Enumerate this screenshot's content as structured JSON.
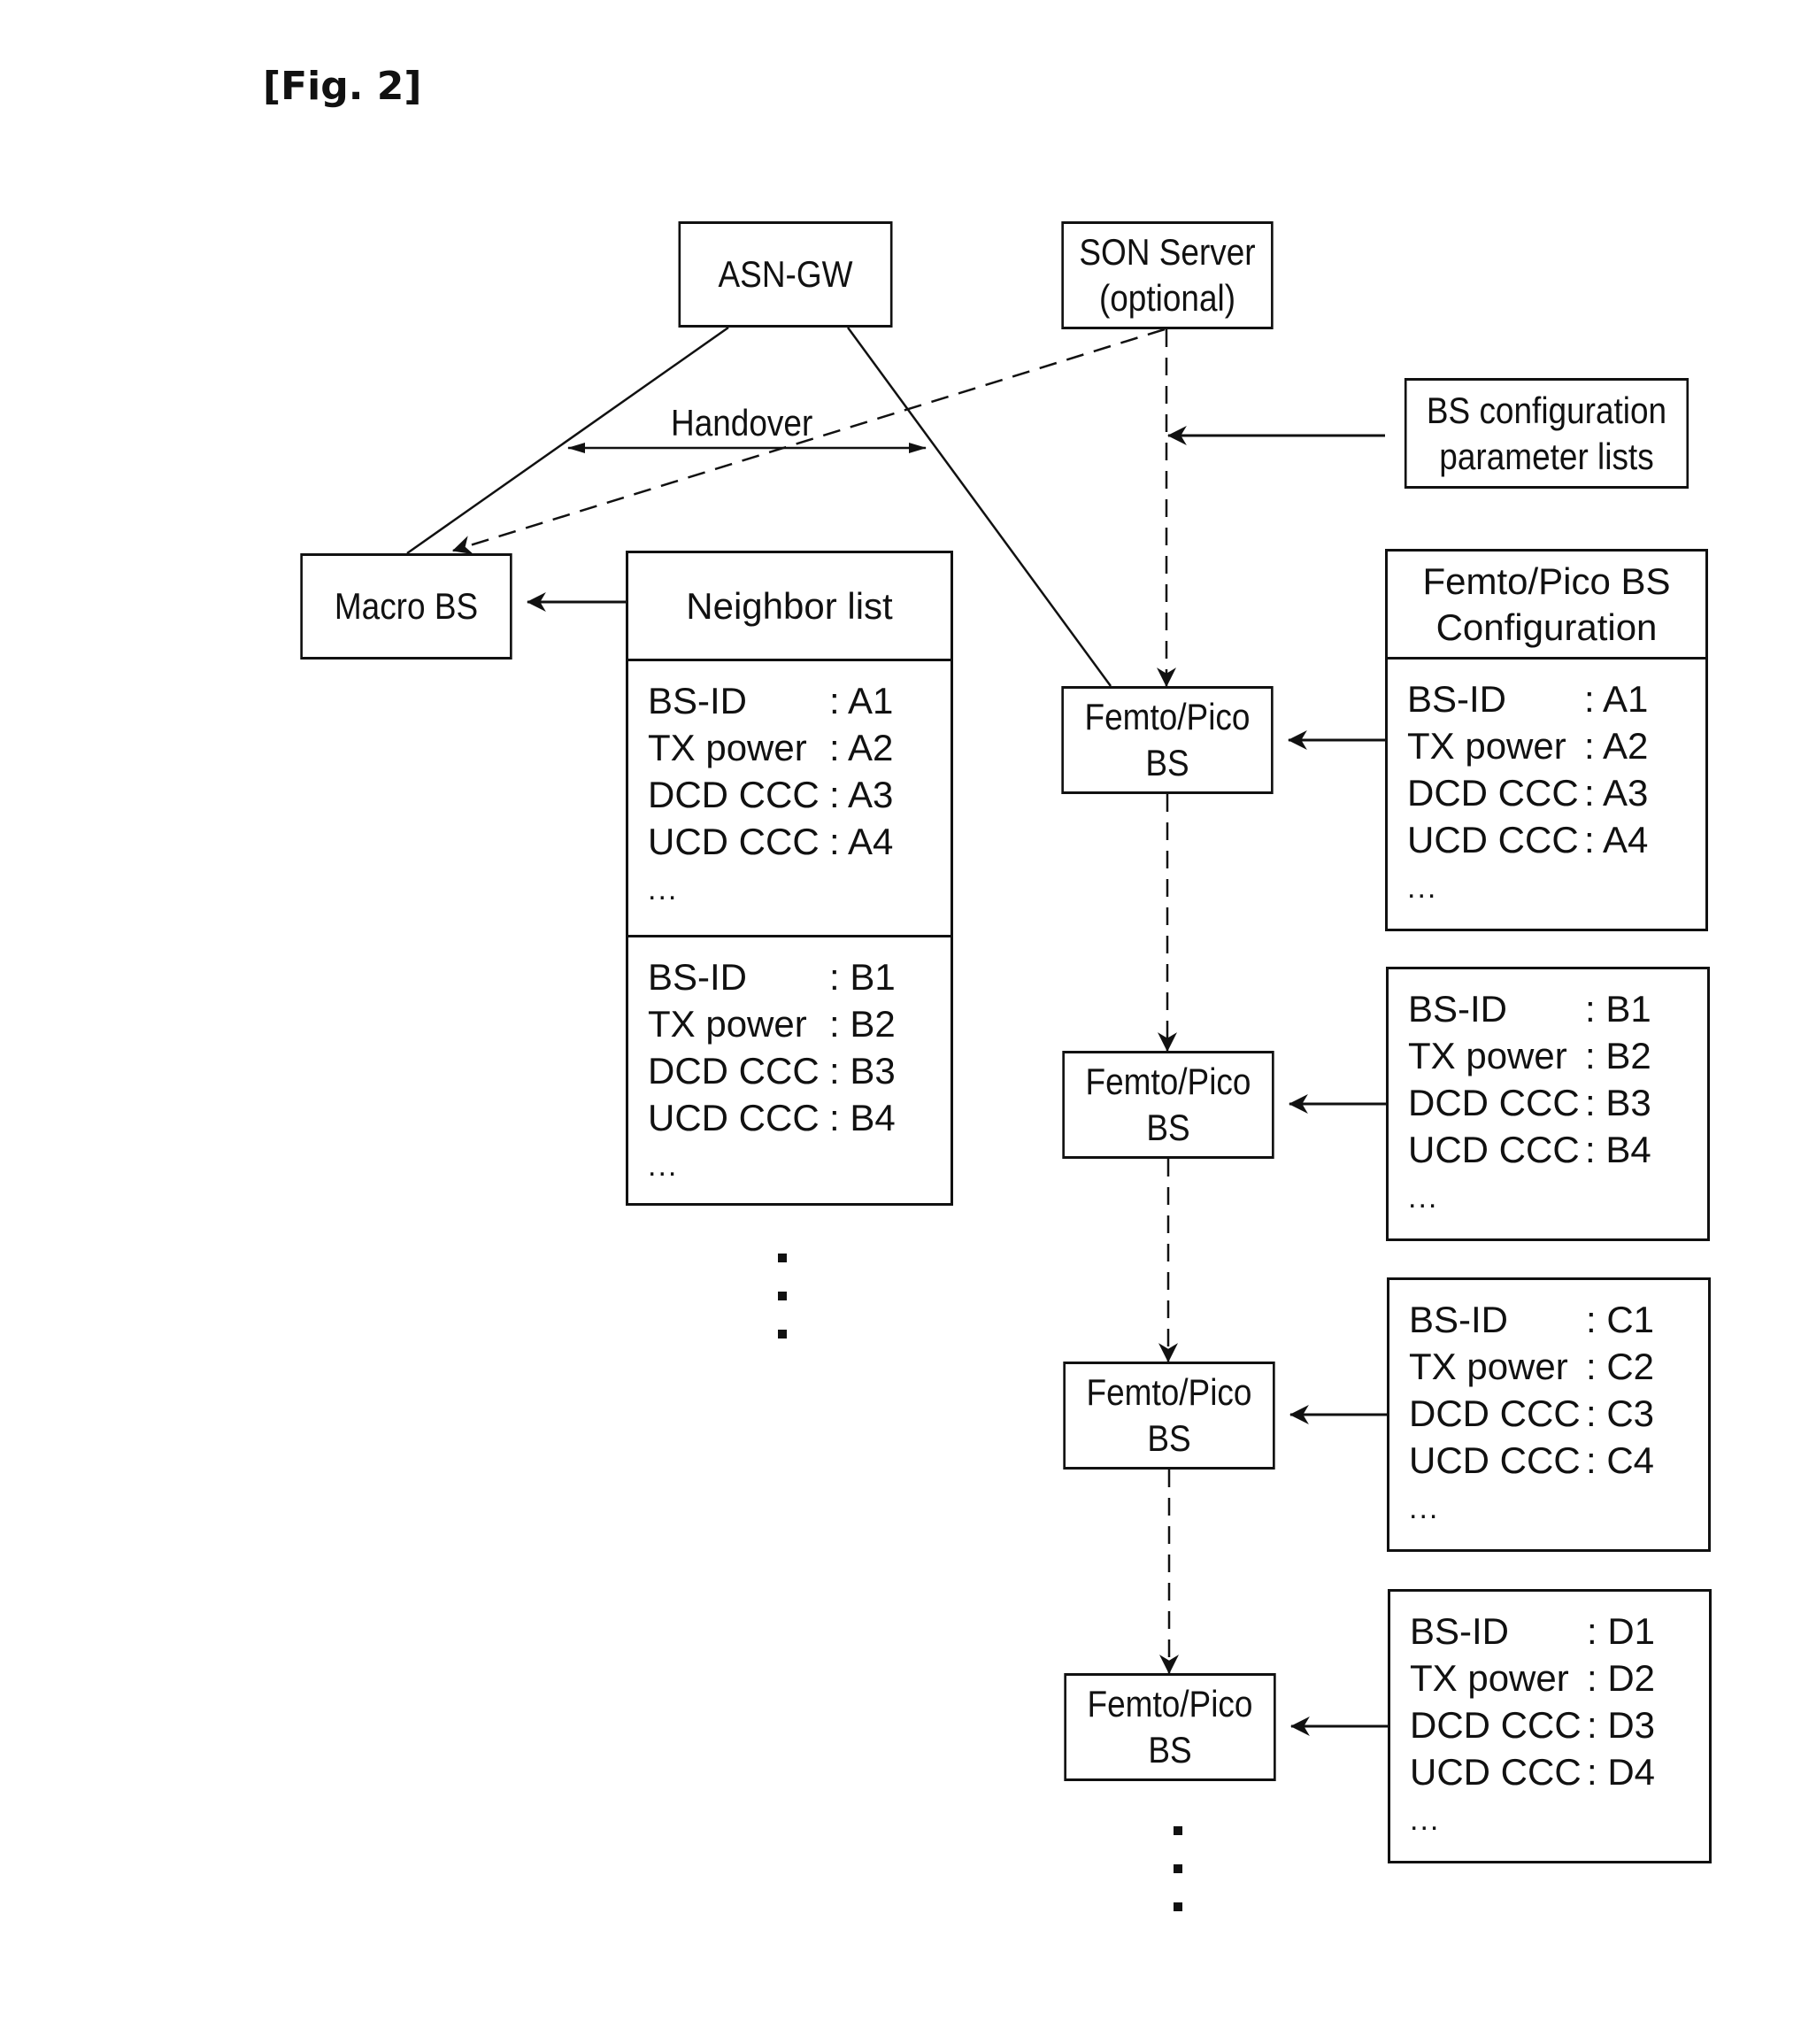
{
  "figure": {
    "label": "[Fig. 2]"
  },
  "nodes": {
    "asn_gw": {
      "lines": [
        "ASN-GW"
      ]
    },
    "son_server": {
      "lines": [
        "SON Server",
        "(optional)"
      ]
    },
    "bs_config_lists": {
      "lines": [
        "BS configuration",
        "parameter lists"
      ]
    },
    "macro_bs": {
      "lines": [
        "Macro BS"
      ]
    },
    "femto_bs": [
      {
        "lines": [
          "Femto/Pico",
          "BS"
        ]
      },
      {
        "lines": [
          "Femto/Pico",
          "BS"
        ]
      },
      {
        "lines": [
          "Femto/Pico",
          "BS"
        ]
      },
      {
        "lines": [
          "Femto/Pico",
          "BS"
        ]
      }
    ]
  },
  "edges": {
    "handover_label": "Handover"
  },
  "neighbor_list": {
    "title": "Neighbor list",
    "entries": [
      {
        "rows": [
          {
            "key": "BS-ID",
            "value": ": A1"
          },
          {
            "key": "TX power",
            "value": ": A2"
          },
          {
            "key": "DCD CCC",
            "value": ": A3"
          },
          {
            "key": "UCD CCC",
            "value": ": A4"
          }
        ],
        "more": "..."
      },
      {
        "rows": [
          {
            "key": "BS-ID",
            "value": ": B1"
          },
          {
            "key": "TX power",
            "value": ": B2"
          },
          {
            "key": "DCD CCC",
            "value": ": B3"
          },
          {
            "key": "UCD CCC",
            "value": ": B4"
          }
        ],
        "more": "..."
      }
    ]
  },
  "femto_config": {
    "title_lines": [
      "Femto/Pico BS",
      "Configuration"
    ],
    "entries": [
      {
        "rows": [
          {
            "key": "BS-ID",
            "value": ": A1"
          },
          {
            "key": "TX power",
            "value": ": A2"
          },
          {
            "key": "DCD CCC",
            "value": ": A3"
          },
          {
            "key": "UCD CCC",
            "value": ": A4"
          }
        ],
        "more": "..."
      },
      {
        "rows": [
          {
            "key": "BS-ID",
            "value": ": B1"
          },
          {
            "key": "TX power",
            "value": ": B2"
          },
          {
            "key": "DCD CCC",
            "value": ": B3"
          },
          {
            "key": "UCD CCC",
            "value": ": B4"
          }
        ],
        "more": "..."
      },
      {
        "rows": [
          {
            "key": "BS-ID",
            "value": ": C1"
          },
          {
            "key": "TX power",
            "value": ": C2"
          },
          {
            "key": "DCD CCC",
            "value": ": C3"
          },
          {
            "key": "UCD CCC",
            "value": ": C4"
          }
        ],
        "more": "..."
      },
      {
        "rows": [
          {
            "key": "BS-ID",
            "value": ": D1"
          },
          {
            "key": "TX power",
            "value": ": D2"
          },
          {
            "key": "DCD CCC",
            "value": ": D3"
          },
          {
            "key": "UCD CCC",
            "value": ": D4"
          }
        ],
        "more": "..."
      }
    ]
  }
}
